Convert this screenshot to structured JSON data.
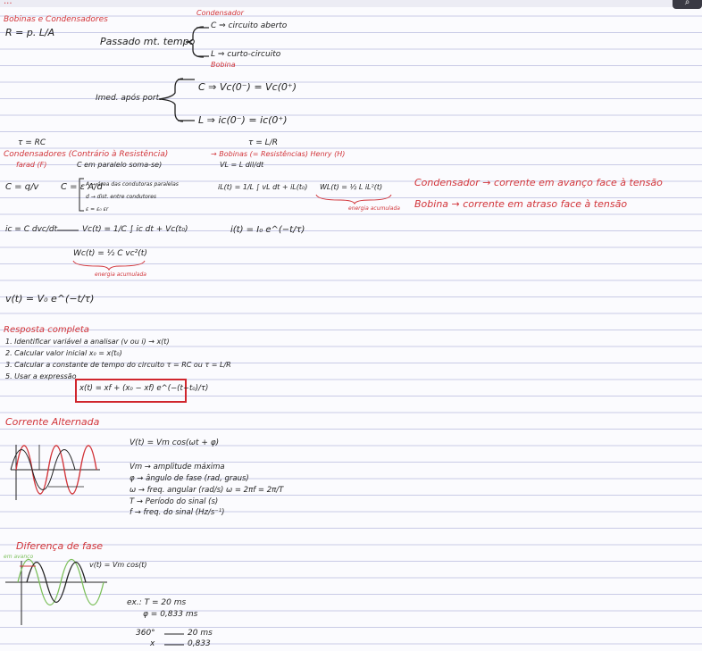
{
  "header": {
    "title_fragment": "...",
    "search_label": "Q"
  },
  "sec1": {
    "title": "Bobinas e Condensadores",
    "resist_formula": "R = p. L/A",
    "passado": "Passado mt. tempo",
    "condensador_label": "Condensador",
    "c_branch": "C ⇒ circuito aberto",
    "l_branch": "L ⇒ curto-circuito",
    "bobina_label": "Bobina",
    "imed": "Imed. após port.",
    "c_imed": "C ⇒ Vc(0⁻) = Vc(0⁺)",
    "l_imed": "L ⇒ ic(0⁻) = ic(0⁺)"
  },
  "sec2": {
    "tau_rc": "τ = RC",
    "tau_lr": "τ = L/R",
    "cond_title": "Condensadores (Contrário à Resistência)",
    "farad": "farad (F)",
    "em_paralelo": "C em paralelo soma-se)",
    "bob_title": "→ Bobinas (= Resistências) Henry (H)",
    "vl": "VL = L dil/dt",
    "c_eq": "C = q/v",
    "c_eps": "C = ε A/d",
    "c_note1": "A → área das condutoras paralelas",
    "c_note2": "d → dist. entre condutores",
    "c_note3": "ε = ε₀ εr",
    "il": "iL(t) = 1/L ∫ vL dt + iL(t₀)",
    "wl": "WL(t) = ½ L iL²(t)",
    "energia_acum": "energia acumulada",
    "ic": "ic = C dvc/dt",
    "vc": "Vc(t) = 1/C ∫ ic dt + Vc(t₀)",
    "i_exp": "i(t) = I₀ e^(−t/τ)",
    "wc": "Wc(t) = ½ C vc²(t)",
    "energia_acum2": "energia acumulada",
    "cond_avanco": "Condensador → corrente em avanço face à tensão",
    "bob_atraso": "Bobina → corrente em atraso face à tensão",
    "v_exp": "v(t) = V₀ e^(−t/τ)"
  },
  "sec3": {
    "title": "Resposta completa",
    "step1": "1. Identificar variável a analisar (v ou i) → x(t)",
    "step2": "2. Calcular valor inicial x₀ = x(t₀)",
    "step3": "3. Calcular a constante de tempo do circuito τ = RC ou τ = L/R",
    "step4": "5. Usar a expressão",
    "formula": "x(t) = xf + (x₀ − xf) e^(−(t−t₀)/τ)"
  },
  "sec4": {
    "title": "Corrente Alternada",
    "vt": "V(t) = Vm cos(ωt + φ)",
    "l1": "Vm → amplitude máxima",
    "l2": "φ → ângulo de fase (rad, graus)",
    "l3": "ω → freq. angular (rad/s)   ω = 2πf = 2π/T",
    "l4": "T → Período do sinal (s)",
    "l5": "f → freq. do sinal (Hz/s⁻¹)"
  },
  "sec5": {
    "title": "Diferença de fase",
    "avanco": "em avanço",
    "vt": "v(t) = Vm cos(t)",
    "ex": "ex.: T = 20 ms",
    "phi": "φ = 0,833 ms",
    "r1a": "360°",
    "r1b": "20 ms",
    "r2a": "x",
    "r2b": "0,833"
  },
  "colors": {
    "red": "#d2353a",
    "ink": "#222222",
    "box": "#d0262d",
    "green": "#7bbf5a",
    "line": "#c9cbe6"
  }
}
